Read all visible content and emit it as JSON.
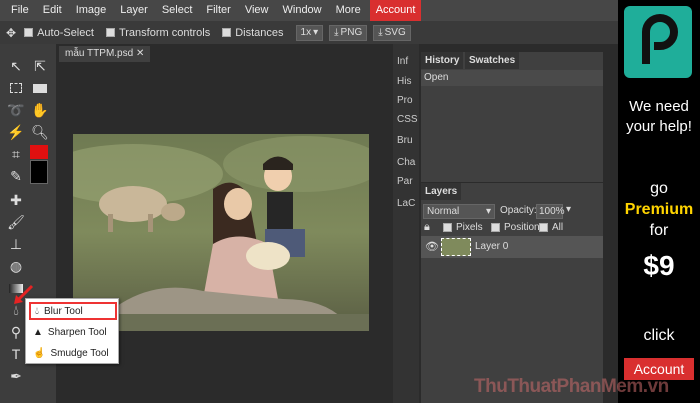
{
  "menubar": {
    "items": [
      "File",
      "Edit",
      "Image",
      "Layer",
      "Select",
      "Filter",
      "View",
      "Window",
      "More"
    ],
    "account": "Account"
  },
  "optbar": {
    "auto_select": "Auto-Select",
    "transform": "Transform controls",
    "distances": "Distances",
    "zoom": "1x",
    "png": "PNG",
    "svg": "SVG"
  },
  "document": {
    "tab": "mẫu TTPM.psd"
  },
  "rightnav": [
    "Inf",
    "His",
    "Pro",
    "CSS",
    "Bru",
    "Cha",
    "Par",
    "LaC"
  ],
  "history": {
    "tabs": [
      "History",
      "Swatches"
    ],
    "items": [
      "Open"
    ]
  },
  "layers": {
    "title": "Layers",
    "blend": "Normal",
    "opacity_label": "Opacity:",
    "opacity": "100%",
    "lock_pixels": "Pixels",
    "lock_position": "Position",
    "lock_all": "All",
    "layer_name": "Layer 0"
  },
  "popup": {
    "items": [
      "Blur Tool",
      "Sharpen Tool",
      "Smudge Tool"
    ]
  },
  "ad": {
    "line1": "We need",
    "line2": "your help!",
    "go": "go",
    "premium": "Premium",
    "for": "for",
    "price": "$9",
    "click": "click",
    "account": "Account"
  },
  "watermark": "ThuThuatPhanMem.vn",
  "colors": {
    "accent": "#d92f2f",
    "ad_green": "#1fae9a",
    "premium": "#ffd400"
  }
}
